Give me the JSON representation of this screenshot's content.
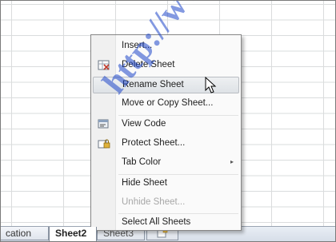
{
  "colors": {
    "menu_bg": "#fafafa",
    "menu_hover": "#e6e9ec",
    "disabled_text": "#a7a7a7",
    "grid_line": "#dadcdd",
    "watermark": "#1e46c8"
  },
  "context_menu": {
    "items": [
      {
        "label": "Insert...",
        "icon": null
      },
      {
        "label": "Delete Sheet",
        "icon": "delete-sheet-icon"
      },
      {
        "label": "Rename Sheet",
        "icon": null,
        "highlighted": true
      },
      {
        "label": "Move or Copy Sheet...",
        "icon": null
      },
      {
        "label": "View Code",
        "icon": "view-code-icon"
      },
      {
        "label": "Protect Sheet...",
        "icon": "protect-sheet-icon"
      },
      {
        "label": "Tab Color",
        "icon": null,
        "submenu": true
      },
      {
        "label": "Hide Sheet",
        "icon": null
      },
      {
        "label": "Unhide Sheet...",
        "icon": null,
        "disabled": true
      },
      {
        "label": "Select All Sheets",
        "icon": null
      }
    ]
  },
  "sheet_tabs": {
    "tabs": [
      {
        "label": "cation",
        "active": false
      },
      {
        "label": "Sheet2",
        "active": true
      },
      {
        "label": "Sheet3",
        "active": false
      }
    ]
  },
  "watermark": "http://www."
}
